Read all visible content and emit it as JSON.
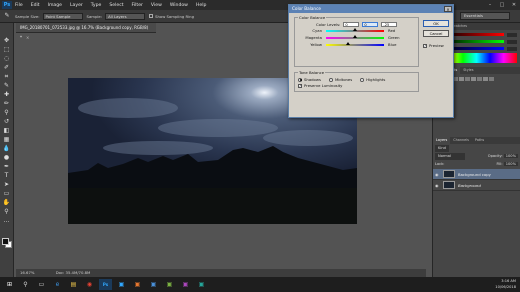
{
  "menubar": {
    "logo": "Ps",
    "items": [
      "File",
      "Edit",
      "Image",
      "Layer",
      "Type",
      "Select",
      "Filter",
      "View",
      "Window",
      "Help"
    ]
  },
  "options_bar": {
    "sample_size_label": "Sample Size:",
    "sample_size_value": "Point Sample",
    "sample_label": "Sample:",
    "sample_value": "All Layers",
    "show_ring_label": "Show Sampling Ring",
    "workspace": "Essentials"
  },
  "document_tab": {
    "title": "IMG_20180701_072533.jpg @ 16.7% (Background copy, RGB/8) *",
    "close": "×"
  },
  "status_bar": {
    "zoom": "16.67%",
    "doc_info": "Doc: 35.4M/70.8M"
  },
  "dialog": {
    "title": "Color Balance",
    "close": "×",
    "color_balance_legend": "Color Balance",
    "color_levels_label": "Color Levels:",
    "color_levels": [
      "0",
      "0",
      "-25"
    ],
    "sliders": [
      {
        "left": "Cyan",
        "right": "Red",
        "value": 0
      },
      {
        "left": "Magenta",
        "right": "Green",
        "value": 0
      },
      {
        "left": "Yellow",
        "right": "Blue",
        "value": -25
      }
    ],
    "tone_balance_legend": "Tone Balance",
    "tones": [
      "Shadows",
      "Midtones",
      "Highlights"
    ],
    "selected_tone": "Shadows",
    "preserve_luminosity_label": "Preserve Luminosity",
    "preserve_luminosity": true,
    "ok_label": "OK",
    "cancel_label": "Cancel",
    "preview_label": "Preview",
    "preview": true
  },
  "right_panel": {
    "color_tabs": [
      "Color",
      "Swatches"
    ],
    "adjust_tabs": [
      "Adjustments",
      "Styles"
    ],
    "layers_tabs": [
      "Layers",
      "Channels",
      "Paths"
    ],
    "kind_label": "Kind",
    "mode": "Normal",
    "opacity_label": "Opacity:",
    "opacity": "100%",
    "lock_label": "Lock:",
    "fill_label": "Fill:",
    "fill": "100%",
    "layers": [
      {
        "name": "Background copy",
        "selected": true
      },
      {
        "name": "Background",
        "selected": false
      }
    ]
  },
  "taskbar": {
    "time": "3:16 AM",
    "date": "10/06/2018",
    "apps": [
      "windows-icon",
      "search-icon",
      "task-view-icon",
      "edge-icon",
      "file-explorer-icon",
      "chrome-icon",
      "photoshop-icon",
      "app-icon-7",
      "app-icon-8",
      "app-icon-9",
      "app-icon-10",
      "app-icon-11",
      "app-icon-12"
    ]
  },
  "colors": {
    "accent": "#5c82b5",
    "foreground": "#111111",
    "background": "#ffffff"
  }
}
